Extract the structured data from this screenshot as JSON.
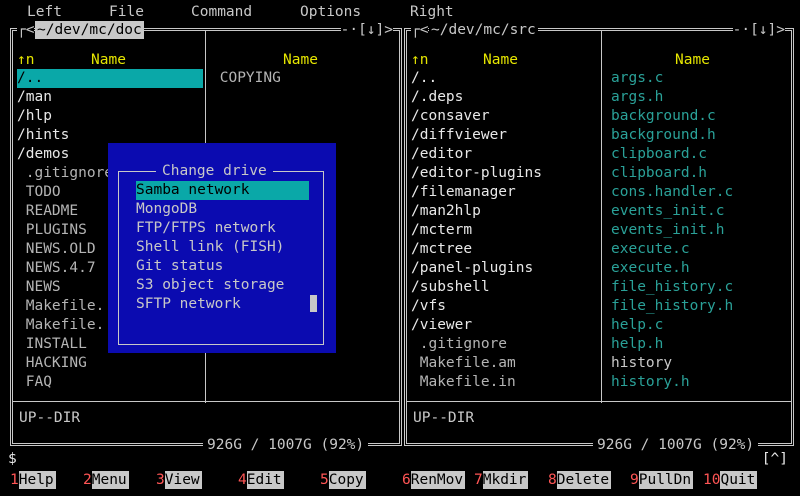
{
  "menubar": {
    "items": [
      "Left",
      "File",
      "Command",
      "Options",
      "Right"
    ]
  },
  "left_panel": {
    "path": "~/dev/mc/doc",
    "corner_left": "┌<",
    "corner_right": "-·[↓]>",
    "sort_indicator": "↑n",
    "col1_header": "Name",
    "col2_header": "Name",
    "col1_files": [
      {
        "name": "/..",
        "kind": "dir",
        "selected": true
      },
      {
        "name": "/man",
        "kind": "dir"
      },
      {
        "name": "/hlp",
        "kind": "dir"
      },
      {
        "name": "/hints",
        "kind": "dir"
      },
      {
        "name": "/demos",
        "kind": "dir"
      },
      {
        "name": " .gitignore",
        "kind": "file"
      },
      {
        "name": " TODO",
        "kind": "file"
      },
      {
        "name": " README",
        "kind": "file"
      },
      {
        "name": " PLUGINS",
        "kind": "file"
      },
      {
        "name": " NEWS.OLD",
        "kind": "file"
      },
      {
        "name": " NEWS.4.7",
        "kind": "file"
      },
      {
        "name": " NEWS",
        "kind": "file"
      },
      {
        "name": " Makefile.",
        "kind": "file"
      },
      {
        "name": " Makefile.",
        "kind": "file"
      },
      {
        "name": " INSTALL",
        "kind": "file"
      },
      {
        "name": " HACKING",
        "kind": "file"
      },
      {
        "name": " FAQ",
        "kind": "file"
      }
    ],
    "col2_files": [
      {
        "name": " COPYING",
        "kind": "file"
      }
    ],
    "mini_status": "UP--DIR",
    "disk_info": "926G / 1007G (92%)"
  },
  "right_panel": {
    "path": "~/dev/mc/src",
    "corner_left": "┌<",
    "corner_right": "-·[↓]>",
    "sort_indicator": "↑n",
    "col1_header": "Name",
    "col2_header": "Name",
    "col1_files": [
      {
        "name": "/..",
        "kind": "dir"
      },
      {
        "name": "/.deps",
        "kind": "dir"
      },
      {
        "name": "/consaver",
        "kind": "dir"
      },
      {
        "name": "/diffviewer",
        "kind": "dir"
      },
      {
        "name": "/editor",
        "kind": "dir"
      },
      {
        "name": "/editor-plugins",
        "kind": "dir"
      },
      {
        "name": "/filemanager",
        "kind": "dir"
      },
      {
        "name": "/man2hlp",
        "kind": "dir"
      },
      {
        "name": "/mcterm",
        "kind": "dir"
      },
      {
        "name": "/mctree",
        "kind": "dir"
      },
      {
        "name": "/panel-plugins",
        "kind": "dir"
      },
      {
        "name": "/subshell",
        "kind": "dir"
      },
      {
        "name": "/vfs",
        "kind": "dir"
      },
      {
        "name": "/viewer",
        "kind": "dir"
      },
      {
        "name": " .gitignore",
        "kind": "file"
      },
      {
        "name": " Makefile.am",
        "kind": "file"
      },
      {
        "name": " Makefile.in",
        "kind": "file"
      }
    ],
    "col2_files": [
      {
        "name": "args.c",
        "kind": "source"
      },
      {
        "name": "args.h",
        "kind": "source"
      },
      {
        "name": "background.c",
        "kind": "source"
      },
      {
        "name": "background.h",
        "kind": "source"
      },
      {
        "name": "clipboard.c",
        "kind": "source"
      },
      {
        "name": "clipboard.h",
        "kind": "source"
      },
      {
        "name": "cons.handler.c",
        "kind": "source"
      },
      {
        "name": "events_init.c",
        "kind": "source"
      },
      {
        "name": "events_init.h",
        "kind": "source"
      },
      {
        "name": "execute.c",
        "kind": "source"
      },
      {
        "name": "execute.h",
        "kind": "source"
      },
      {
        "name": "file_history.c",
        "kind": "source"
      },
      {
        "name": "file_history.h",
        "kind": "source"
      },
      {
        "name": "help.c",
        "kind": "source"
      },
      {
        "name": "help.h",
        "kind": "source"
      },
      {
        "name": "history",
        "kind": "plain"
      },
      {
        "name": "history.h",
        "kind": "source"
      }
    ],
    "mini_status": "UP--DIR",
    "disk_info": "926G / 1007G (92%)"
  },
  "dialog": {
    "title": "Change drive",
    "items": [
      {
        "label": "Samba network",
        "selected": true
      },
      {
        "label": "MongoDB"
      },
      {
        "label": "FTP/FTPS network"
      },
      {
        "label": "Shell link (FISH)"
      },
      {
        "label": "Git status"
      },
      {
        "label": "S3 object storage"
      },
      {
        "label": "SFTP network"
      }
    ]
  },
  "command_line": {
    "prompt": "$",
    "history_button": "[^]"
  },
  "fkeys": [
    {
      "num": "1",
      "label": "Help"
    },
    {
      "num": "2",
      "label": "Menu"
    },
    {
      "num": "3",
      "label": "View"
    },
    {
      "num": "4",
      "label": "Edit"
    },
    {
      "num": "5",
      "label": "Copy"
    },
    {
      "num": "6",
      "label": "RenMov"
    },
    {
      "num": "7",
      "label": "Mkdir"
    },
    {
      "num": "8",
      "label": "Delete"
    },
    {
      "num": "9",
      "label": "PullDn"
    },
    {
      "num": "10",
      "label": "Quit"
    }
  ],
  "colors": {
    "dialog_bg": "#0b0bb0",
    "selection": "#0aa8a8",
    "header_yellow": "#e6e600",
    "source_teal": "#2aa198",
    "fkey_number_red": "#ff5555"
  }
}
